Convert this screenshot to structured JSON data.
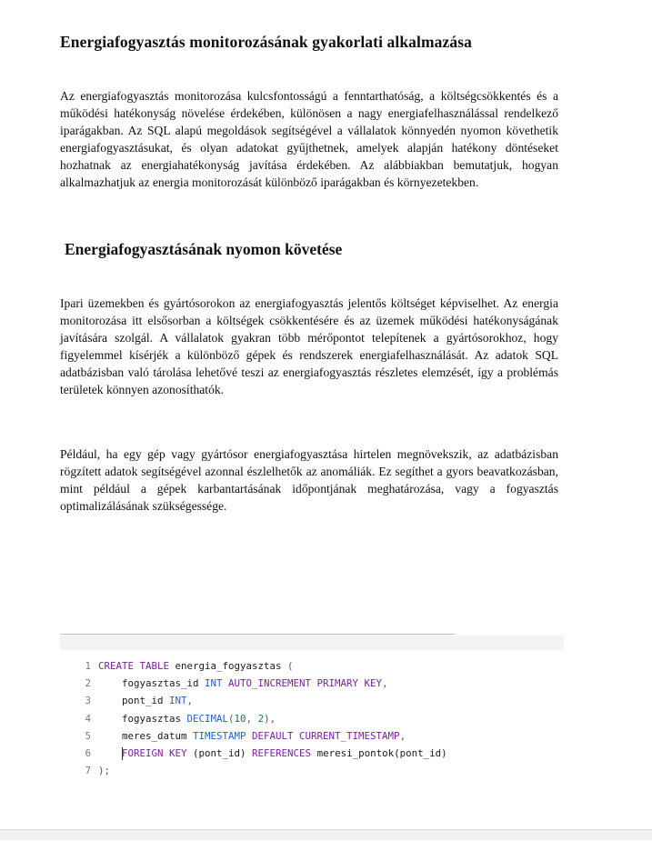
{
  "document": {
    "title": "Energiafogyasztás monitorozásának gyakorlati alkalmazása",
    "intro_paragraph": "Az energiafogyasztás monitorozása kulcsfontosságú a fenntarthatóság, a költségcsökkentés és a működési hatékonyság növelése érdekében, különösen a nagy energiafelhasználással rendelkező iparágakban. Az SQL alapú megoldások segítségével a vállalatok könnyedén nyomon követhetik energiafogyasztásukat, és olyan adatokat gyűjthetnek, amelyek alapján hatékony döntéseket hozhatnak az energiahatékonyság javítása érdekében. Az alábbiakban bemutatjuk, hogyan alkalmazhatjuk az energia monitorozását különböző iparágakban és környezetekben.",
    "section_title": "Energiafogyasztásának nyomon követése",
    "section_paragraph_1": "Ipari üzemekben és gyártósorokon az energiafogyasztás jelentős költséget képviselhet. Az energia monitorozása itt elsősorban a költségek csökkentésére és az üzemek működési hatékonyságának javítására szolgál. A vállalatok gyakran több mérőpontot telepítenek a gyártósorokhoz, hogy figyelemmel kísérjék a különböző gépek és rendszerek energiafelhasználását. Az adatok SQL adatbázisban való tárolása lehetővé teszi az energiafogyasztás részletes elemzését, így a problémás területek könnyen azonosíthatók.",
    "section_paragraph_2": "Például, ha egy gép vagy gyártósor energiafogyasztása hirtelen megnövekszik, az adatbázisban rögzített adatok segítségével azonnal észlelhetők az anomáliák. Ez segíthet a gyors beavatkozásban, mint például a gépek karbantartásának időpontjának meghatározása, vagy a fogyasztás optimalizálásának szükségessége."
  },
  "code_block": {
    "line_numbers": [
      "1",
      "2",
      "3",
      "4",
      "5",
      "6",
      "7"
    ],
    "lines": [
      [
        {
          "t": "CREATE TABLE",
          "c": "kw"
        },
        {
          "t": " energia_fogyasztas ",
          "c": "pl"
        },
        {
          "t": "(",
          "c": "pu"
        }
      ],
      [
        {
          "t": "    fogyasztas_id ",
          "c": "pl"
        },
        {
          "t": "INT",
          "c": "ty"
        },
        {
          "t": " ",
          "c": "pl"
        },
        {
          "t": "AUTO_INCREMENT PRIMARY KEY",
          "c": "kw"
        },
        {
          "t": ",",
          "c": "pu"
        }
      ],
      [
        {
          "t": "    pont_id ",
          "c": "pl"
        },
        {
          "t": "INT",
          "c": "ty"
        },
        {
          "t": ",",
          "c": "pu"
        }
      ],
      [
        {
          "t": "    fogyasztas ",
          "c": "pl"
        },
        {
          "t": "DECIMAL",
          "c": "ty"
        },
        {
          "t": "(",
          "c": "pu"
        },
        {
          "t": "10",
          "c": "num"
        },
        {
          "t": ", ",
          "c": "pu"
        },
        {
          "t": "2",
          "c": "num"
        },
        {
          "t": "),",
          "c": "pu"
        }
      ],
      [
        {
          "t": "    meres_datum ",
          "c": "pl"
        },
        {
          "t": "TIMESTAMP",
          "c": "ty"
        },
        {
          "t": " ",
          "c": "pl"
        },
        {
          "t": "DEFAULT CURRENT_TIMESTAMP",
          "c": "kw"
        },
        {
          "t": ",",
          "c": "pu"
        }
      ],
      [
        {
          "t": "    ",
          "c": "pl"
        },
        {
          "t": "|",
          "c": "cursor"
        },
        {
          "t": "FOREIGN KEY",
          "c": "kw"
        },
        {
          "t": " (pont_id) ",
          "c": "pl"
        },
        {
          "t": "REFERENCES",
          "c": "kw"
        },
        {
          "t": " meresi_pontok(pont_id)",
          "c": "pl"
        }
      ],
      [
        {
          "t": ");",
          "c": "pu"
        }
      ]
    ]
  }
}
